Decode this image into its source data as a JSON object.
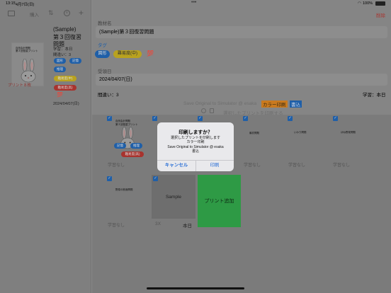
{
  "status_bar": {
    "time": "13:15",
    "date": "4月7日(日)",
    "battery": "100%"
  },
  "sidebar": {
    "toolbar": {
      "import_label": "購入"
    },
    "thumbnail": {
      "line1": "自然会計問題",
      "line2": "第３回復習プリント"
    },
    "print_count_label": "プリント８枚",
    "item": {
      "title": "(Sample)\n第３回復習\n問題",
      "study_label": "学習：本日",
      "mistakes_label": "間違い：3",
      "tags": [
        "図形",
        "記憶",
        "推理",
        "難易度(中)",
        "難易度(高)"
      ],
      "emoji": "💯",
      "date": "2024/04/07(日)"
    }
  },
  "main": {
    "delete_label": "削除",
    "material_name_label": "教材名",
    "material_name_value": "(Sample)第３回復習問題",
    "tag_label": "タグ",
    "tags": [
      "図形",
      "難易度(中)"
    ],
    "tag_emoji": "💯",
    "received_date_label": "受領日",
    "received_date_value": "2024/04/07(日)",
    "mistakes_label": "間違い：3",
    "study_label": "学習：本日",
    "save_line": {
      "text": "Save Original to Simulator @ esaka",
      "color_print": "カラー印刷",
      "mode": "書込"
    },
    "print_selected": "選択したプリントを印刷する"
  },
  "grid": {
    "cards": [
      {
        "title_line1": "自然会計問題",
        "title_line2": "第３回復習プリント",
        "status": "学習なし",
        "tags": [
          "記憶",
          "推理",
          "難易度(高)"
        ]
      },
      {
        "title_line1": "",
        "title_line2": "",
        "status": "学習なし",
        "tags": []
      },
      {
        "title_line1": "",
        "title_line2": "",
        "status": "学習なし",
        "tags": []
      },
      {
        "title_line1": "最初問題",
        "title_line2": "",
        "status": "学習なし",
        "tags": []
      },
      {
        "title_line1": "いわり問題",
        "title_line2": "",
        "status": "学習なし",
        "tags": []
      },
      {
        "title_line1": "ほね野菜問題",
        "title_line2": "",
        "status": "学習なし",
        "tags": []
      },
      {
        "title_line1": "野菜の断面問題",
        "title_line2": "",
        "status": "学習なし",
        "tags": []
      }
    ],
    "sample_card": {
      "label": "Sample",
      "count": "3X",
      "date": "本日"
    },
    "add_print_label": "プリント追加"
  },
  "dialog": {
    "title": "印刷しますか？",
    "line1": "選択したプリントを印刷します",
    "line2": "カラー印刷",
    "line3": "Save Original to Simulator @ esaka",
    "line4": "書込",
    "cancel_label": "キャンセル",
    "print_label": "印刷"
  },
  "colors": {
    "accent": "#2a6fd6",
    "destructive": "#c0392b",
    "tag_blue": "#1f5fa8",
    "tag_yellow": "#b9a21f",
    "tag_red": "#a8332e",
    "add_green": "#2e9a45"
  }
}
